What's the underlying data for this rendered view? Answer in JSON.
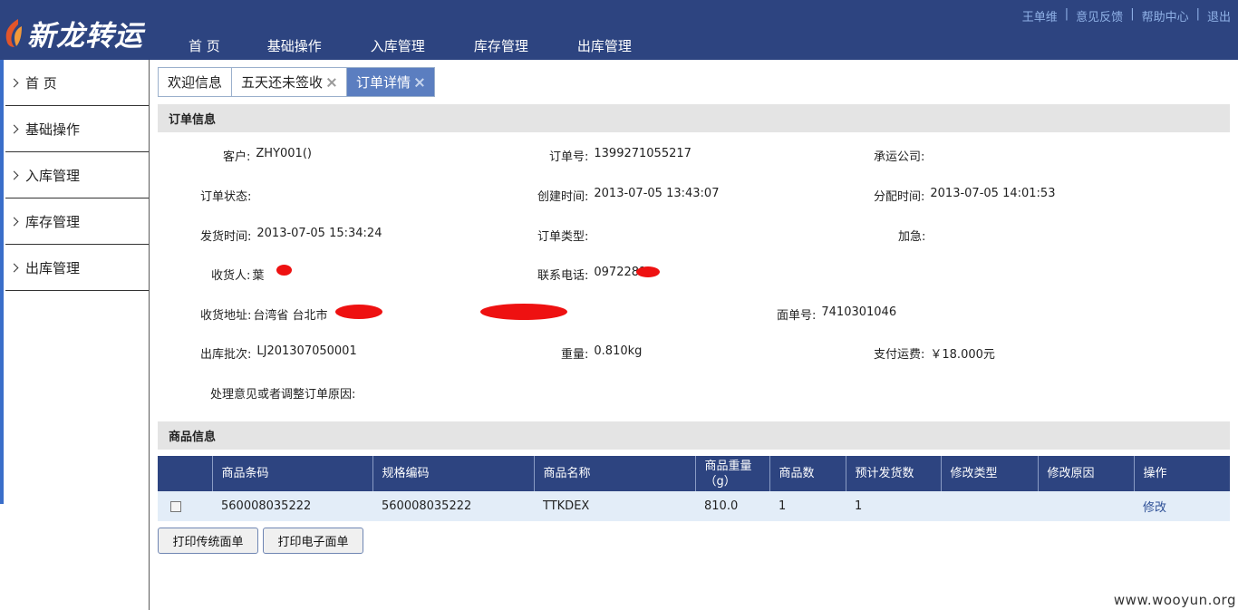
{
  "app": {
    "logo_text": "新龙转运",
    "top_nav": [
      "首 页",
      "基础操作",
      "入库管理",
      "库存管理",
      "出库管理"
    ],
    "top_links": [
      "王单维",
      "意见反馈",
      "帮助中心",
      "退出"
    ]
  },
  "sidebar": {
    "items": [
      "首 页",
      "基础操作",
      "入库管理",
      "库存管理",
      "出库管理"
    ]
  },
  "tabs": [
    {
      "label": "欢迎信息",
      "closable": false,
      "active": false
    },
    {
      "label": "五天还未签收",
      "closable": true,
      "active": false
    },
    {
      "label": "订单详情",
      "closable": true,
      "active": true
    }
  ],
  "order_info": {
    "title": "订单信息",
    "customer_label": "客户:",
    "customer": "ZHY001()",
    "order_no_label": "订单号:",
    "order_no": "1399271055217",
    "carrier_label": "承运公司:",
    "carrier": "",
    "status_label": "订单状态:",
    "status": "",
    "created_label": "创建时间:",
    "created": "2013-07-05 13:43:07",
    "assigned_label": "分配时间:",
    "assigned": "2013-07-05 14:01:53",
    "shipped_label": "发货时间:",
    "shipped": "2013-07-05 15:34:24",
    "type_label": "订单类型:",
    "type": "",
    "urgent_label": "加急:",
    "urgent": "",
    "receiver_label": "收货人:",
    "receiver": "葉",
    "phone_label": "联系电话:",
    "phone": "0972281",
    "address_label": "收货地址:",
    "address": "台湾省 台北市",
    "waybill_label": "面单号:",
    "waybill": "7410301046",
    "batch_label": "出库批次:",
    "batch": "LJ201307050001",
    "weight_label": "重量:",
    "weight": "0.810kg",
    "fee_label": "支付运费:",
    "fee": "￥18.000元",
    "reason_label": "处理意见或者调整订单原因:",
    "reason": ""
  },
  "goods_info": {
    "title": "商品信息",
    "columns": [
      "",
      "商品条码",
      "规格编码",
      "商品名称",
      "商品重量（g）",
      "商品数",
      "预计发货数",
      "修改类型",
      "修改原因",
      "操作"
    ],
    "rows": [
      {
        "barcode": "560008035222",
        "spec_code": "560008035222",
        "name": "TTKDEX",
        "weight": "810.0",
        "qty": "1",
        "planned_qty": "1",
        "mod_type": "",
        "mod_reason": "",
        "action": "修改"
      }
    ]
  },
  "buttons": {
    "print_traditional": "打印传统面单",
    "print_electronic": "打印电子面单"
  },
  "watermark": "www.wooyun.org",
  "colors": {
    "header_bg": "#2d4480",
    "active_tab": "#5b7ec0",
    "section_bg": "#e4e4e4",
    "row_bg": "#e3edf8",
    "redaction": "#ee1111"
  }
}
